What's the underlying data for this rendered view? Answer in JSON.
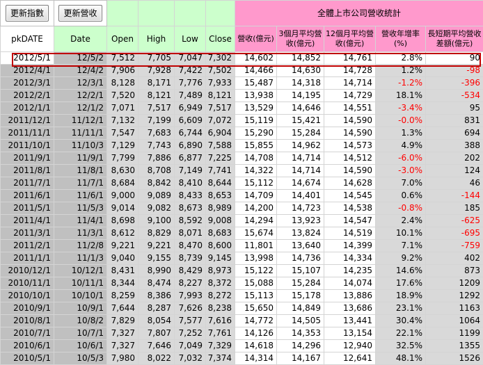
{
  "toolbar": {
    "update_index_label": "更新指數",
    "update_revenue_label": "更新營收"
  },
  "title": "全體上市公司營收統計",
  "headers": {
    "pkdate": "pkDATE",
    "date": "Date",
    "open": "Open",
    "high": "High",
    "low": "Low",
    "close": "Close",
    "revenue": "營收(億元)",
    "avg3": "3個月平均營收(億元)",
    "avg12": "12個月平均營收(億元)",
    "yoy": "營收年增率(%)",
    "diff": "長短期平均營收差額(億元)"
  },
  "colors": {
    "header_green": "#ccffcc",
    "header_pink": "#ff99cc",
    "negative": "#ff0000",
    "highlight_border": "#c00000"
  },
  "rows": [
    [
      "2012/5/1",
      "12/5/2",
      "7,512",
      "7,705",
      "7,047",
      "7,302",
      "14,602",
      "14,852",
      "14,761",
      "2.8%",
      "90"
    ],
    [
      "2012/4/1",
      "12/4/2",
      "7,906",
      "7,928",
      "7,422",
      "7,502",
      "14,466",
      "14,630",
      "14,728",
      "1.2%",
      "-98"
    ],
    [
      "2012/3/1",
      "12/3/1",
      "8,128",
      "8,171",
      "7,776",
      "7,933",
      "15,487",
      "14,318",
      "14,714",
      "-1.2%",
      "-396"
    ],
    [
      "2012/2/1",
      "12/2/1",
      "7,520",
      "8,121",
      "7,489",
      "8,121",
      "13,938",
      "14,195",
      "14,729",
      "18.1%",
      "-534"
    ],
    [
      "2012/1/1",
      "12/1/2",
      "7,071",
      "7,517",
      "6,949",
      "7,517",
      "13,529",
      "14,646",
      "14,551",
      "-3.4%",
      "95"
    ],
    [
      "2011/12/1",
      "11/12/1",
      "7,132",
      "7,199",
      "6,609",
      "7,072",
      "15,119",
      "15,421",
      "14,590",
      "-0.0%",
      "831"
    ],
    [
      "2011/11/1",
      "11/11/1",
      "7,547",
      "7,683",
      "6,744",
      "6,904",
      "15,290",
      "15,284",
      "14,590",
      "1.3%",
      "694"
    ],
    [
      "2011/10/1",
      "11/10/3",
      "7,129",
      "7,743",
      "6,890",
      "7,588",
      "15,855",
      "14,962",
      "14,573",
      "4.9%",
      "388"
    ],
    [
      "2011/9/1",
      "11/9/1",
      "7,799",
      "7,886",
      "6,877",
      "7,225",
      "14,708",
      "14,714",
      "14,512",
      "-6.0%",
      "202"
    ],
    [
      "2011/8/1",
      "11/8/1",
      "8,630",
      "8,708",
      "7,149",
      "7,741",
      "14,322",
      "14,714",
      "14,590",
      "-3.0%",
      "124"
    ],
    [
      "2011/7/1",
      "11/7/1",
      "8,684",
      "8,842",
      "8,410",
      "8,644",
      "15,112",
      "14,674",
      "14,628",
      "7.0%",
      "46"
    ],
    [
      "2011/6/1",
      "11/6/1",
      "9,000",
      "9,089",
      "8,433",
      "8,653",
      "14,709",
      "14,401",
      "14,545",
      "0.6%",
      "-144"
    ],
    [
      "2011/5/1",
      "11/5/3",
      "9,014",
      "9,082",
      "8,673",
      "8,989",
      "14,200",
      "14,723",
      "14,538",
      "-0.8%",
      "185"
    ],
    [
      "2011/4/1",
      "11/4/1",
      "8,698",
      "9,100",
      "8,592",
      "9,008",
      "14,294",
      "13,923",
      "14,547",
      "2.4%",
      "-625"
    ],
    [
      "2011/3/1",
      "11/3/1",
      "8,612",
      "8,829",
      "8,071",
      "8,683",
      "15,674",
      "13,824",
      "14,519",
      "10.1%",
      "-695"
    ],
    [
      "2011/2/1",
      "11/2/8",
      "9,221",
      "9,221",
      "8,470",
      "8,600",
      "11,801",
      "13,640",
      "14,399",
      "7.1%",
      "-759"
    ],
    [
      "2011/1/1",
      "11/1/3",
      "9,040",
      "9,155",
      "8,739",
      "9,145",
      "13,998",
      "14,736",
      "14,334",
      "9.2%",
      "402"
    ],
    [
      "2010/12/1",
      "10/12/1",
      "8,431",
      "8,990",
      "8,429",
      "8,973",
      "15,122",
      "15,107",
      "14,235",
      "14.6%",
      "873"
    ],
    [
      "2010/11/1",
      "10/11/1",
      "8,344",
      "8,474",
      "8,227",
      "8,372",
      "15,088",
      "15,284",
      "14,074",
      "17.6%",
      "1209"
    ],
    [
      "2010/10/1",
      "10/10/1",
      "8,259",
      "8,386",
      "7,993",
      "8,272",
      "15,113",
      "15,178",
      "13,886",
      "18.9%",
      "1292"
    ],
    [
      "2010/9/1",
      "10/9/1",
      "7,644",
      "8,287",
      "7,626",
      "8,238",
      "15,650",
      "14,849",
      "13,686",
      "23.1%",
      "1163"
    ],
    [
      "2010/8/1",
      "10/8/2",
      "7,829",
      "8,054",
      "7,577",
      "7,616",
      "14,772",
      "14,505",
      "13,441",
      "30.4%",
      "1064"
    ],
    [
      "2010/7/1",
      "10/7/1",
      "7,327",
      "7,807",
      "7,252",
      "7,761",
      "14,126",
      "14,353",
      "13,154",
      "22.1%",
      "1199"
    ],
    [
      "2010/6/1",
      "10/6/1",
      "7,327",
      "7,646",
      "7,049",
      "7,329",
      "14,618",
      "14,296",
      "12,940",
      "32.5%",
      "1355"
    ],
    [
      "2010/5/1",
      "10/5/3",
      "7,980",
      "8,022",
      "7,032",
      "7,374",
      "14,314",
      "14,167",
      "12,641",
      "48.1%",
      "1526"
    ]
  ]
}
